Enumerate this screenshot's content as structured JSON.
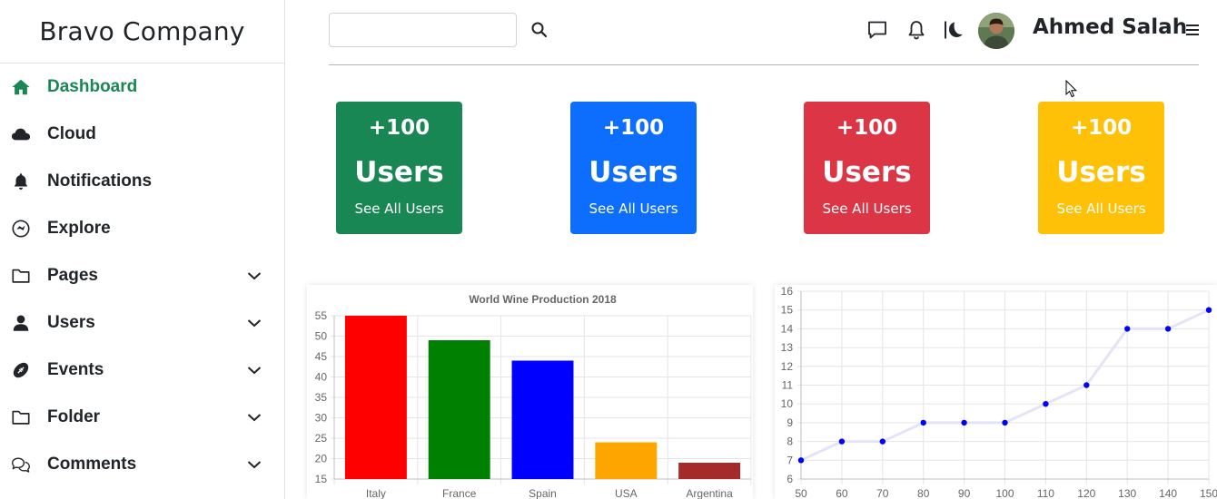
{
  "brand": {
    "name": "Bravo Company"
  },
  "sidebar": {
    "items": [
      {
        "label": "Dashboard",
        "icon": "home-icon",
        "active": true,
        "has_submenu": false
      },
      {
        "label": "Cloud",
        "icon": "cloud-icon",
        "active": false,
        "has_submenu": false
      },
      {
        "label": "Notifications",
        "icon": "bell-icon",
        "active": false,
        "has_submenu": false
      },
      {
        "label": "Explore",
        "icon": "compass-icon",
        "active": false,
        "has_submenu": false
      },
      {
        "label": "Pages",
        "icon": "folder-icon",
        "active": false,
        "has_submenu": true
      },
      {
        "label": "Users",
        "icon": "user-icon",
        "active": false,
        "has_submenu": true
      },
      {
        "label": "Events",
        "icon": "football-icon",
        "active": false,
        "has_submenu": true
      },
      {
        "label": "Folder",
        "icon": "folder-icon",
        "active": false,
        "has_submenu": true
      },
      {
        "label": "Comments",
        "icon": "comments-icon",
        "active": false,
        "has_submenu": true
      }
    ]
  },
  "header": {
    "search": {
      "value": "",
      "placeholder": ""
    },
    "icons": [
      "search-icon",
      "chat-icon",
      "bell-icon",
      "moon-icon",
      "menu-icon"
    ],
    "user_name": "Ahmed Salah"
  },
  "colors": {
    "active": "#198754",
    "success": "#198754",
    "primary": "#0d6efd",
    "danger": "#dc3545",
    "warning": "#ffc107"
  },
  "stat_cards": [
    {
      "count": "+100",
      "title": "Users",
      "link": "See All Users",
      "color": "#198754"
    },
    {
      "count": "+100",
      "title": "Users",
      "link": "See All Users",
      "color": "#0d6efd"
    },
    {
      "count": "+100",
      "title": "Users",
      "link": "See All Users",
      "color": "#dc3545"
    },
    {
      "count": "+100",
      "title": "Users",
      "link": "See All Users",
      "color": "#ffc107"
    }
  ],
  "chart_data": [
    {
      "type": "bar",
      "title": "World Wine Production 2018",
      "categories": [
        "Italy",
        "France",
        "Spain",
        "USA",
        "Argentina"
      ],
      "values": [
        55,
        49,
        44,
        24,
        19
      ],
      "colors": [
        "#ff0000",
        "#008000",
        "#0000ff",
        "#ffa500",
        "#a52a2a"
      ],
      "ylim": [
        15,
        55
      ],
      "yticks": [
        15,
        20,
        25,
        30,
        35,
        40,
        45,
        50,
        55
      ],
      "grid": true,
      "legend": false
    },
    {
      "type": "line",
      "x": [
        50,
        60,
        70,
        80,
        90,
        100,
        110,
        120,
        130,
        140,
        150
      ],
      "y": [
        7,
        8,
        8,
        9,
        9,
        9,
        10,
        11,
        14,
        14,
        15
      ],
      "xlim": [
        50,
        150
      ],
      "ylim": [
        6,
        16
      ],
      "yticks": [
        6,
        7,
        8,
        9,
        10,
        11,
        12,
        13,
        14,
        15,
        16
      ],
      "point_color": "#0000ff",
      "line_color": "#e4e4f7",
      "grid": true,
      "legend": false
    }
  ]
}
